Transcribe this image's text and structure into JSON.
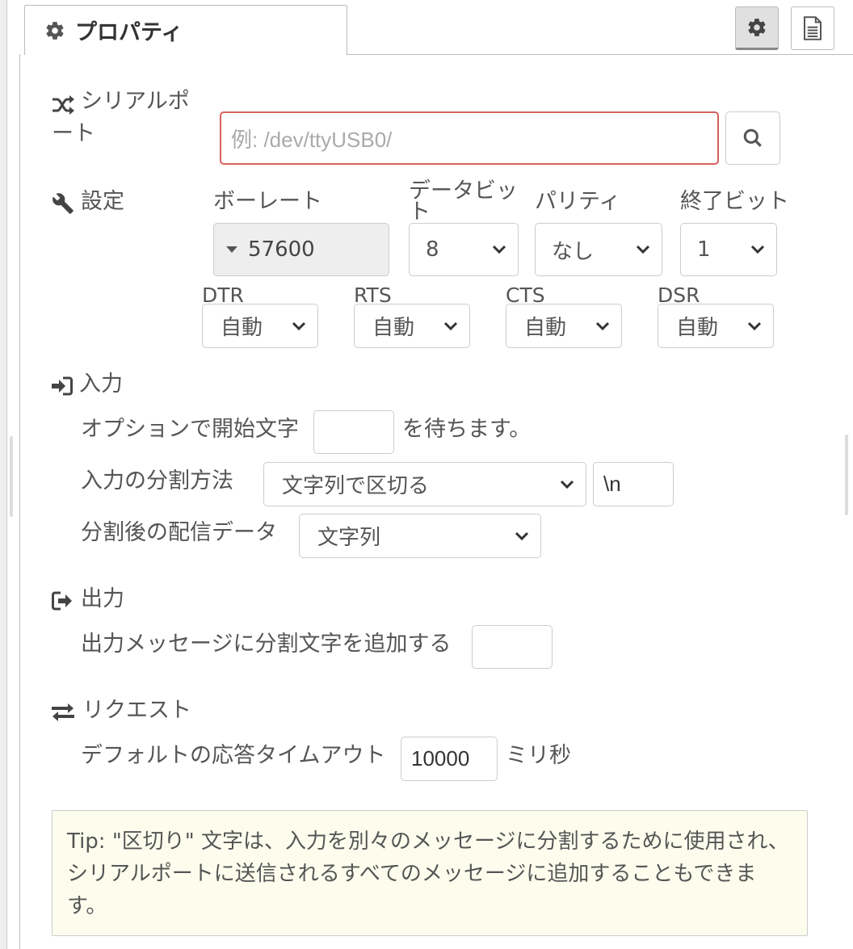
{
  "tab": {
    "title": "プロパティ",
    "icon": "gear-icon"
  },
  "tab_buttons": [
    {
      "icon": "gear-icon",
      "active": true
    },
    {
      "icon": "document-icon",
      "active": false
    }
  ],
  "serial_port": {
    "label_line1": "シリアルポ",
    "label_line2": "ート",
    "placeholder": "例: /dev/ttyUSB0/",
    "value": "",
    "icon": "shuffle-icon",
    "search_icon": "search-icon"
  },
  "settings": {
    "label": "設定",
    "icon": "wrench-icon",
    "baud_label": "ボーレート",
    "baud_value": "57600",
    "databits_label": "データビット",
    "databits_value": "8",
    "parity_label": "パリティ",
    "parity_value": "なし",
    "stopbits_label": "終了ビット",
    "stopbits_value": "1",
    "dtr_label": "DTR",
    "dtr_value": "自動",
    "rts_label": "RTS",
    "rts_value": "自動",
    "cts_label": "CTS",
    "cts_value": "自動",
    "dsr_label": "DSR",
    "dsr_value": "自動"
  },
  "input": {
    "heading": "入力",
    "icon": "sign-in-icon",
    "start_char_label": "オプションで開始文字",
    "start_char_value": "",
    "start_char_suffix": "を待ちます。",
    "split_label": "入力の分割方法",
    "split_value": "文字列で区切る",
    "split_char_value": "\\n",
    "deliver_label": "分割後の配信データ",
    "deliver_value": "文字列"
  },
  "output": {
    "heading": "出力",
    "icon": "sign-out-icon",
    "add_char_label": "出力メッセージに分割文字を追加する",
    "add_char_value": ""
  },
  "request": {
    "heading": "リクエスト",
    "icon": "exchange-icon",
    "timeout_label": "デフォルトの応答タイムアウト",
    "timeout_value": "10000",
    "timeout_unit": "ミリ秒"
  },
  "tip": {
    "text": "Tip: \"区切り\" 文字は、入力を別々のメッセージに分割するために使用され、シリアルポートに送信されるすべてのメッセージに追加することもできます。"
  }
}
